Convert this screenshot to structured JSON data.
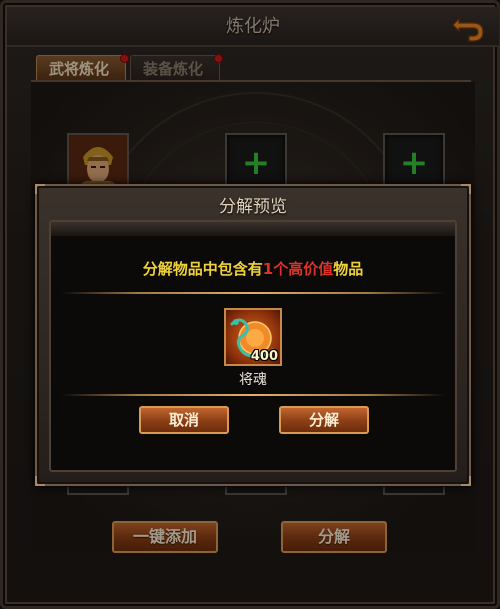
{
  "window": {
    "title": "炼化炉"
  },
  "tabs": [
    {
      "label": "武将炼化",
      "active": true
    },
    {
      "label": "装备炼化",
      "active": false
    }
  ],
  "slots": {
    "plus_symbol": "+"
  },
  "buttons": {
    "one_click_add": "一键添加",
    "decompose": "分解"
  },
  "dialog": {
    "title": "分解预览",
    "message_prefix": "分解物品中包含有",
    "message_highlight": "1个高价值",
    "message_suffix": "物品",
    "item": {
      "name": "将魂",
      "count": "400"
    },
    "cancel_label": "取消",
    "confirm_label": "分解"
  },
  "colors": {
    "accent_orange": "#c1662f",
    "highlight_red": "#e0302a",
    "message_yellow": "#f0d23a",
    "plus_green": "#39c43a"
  }
}
